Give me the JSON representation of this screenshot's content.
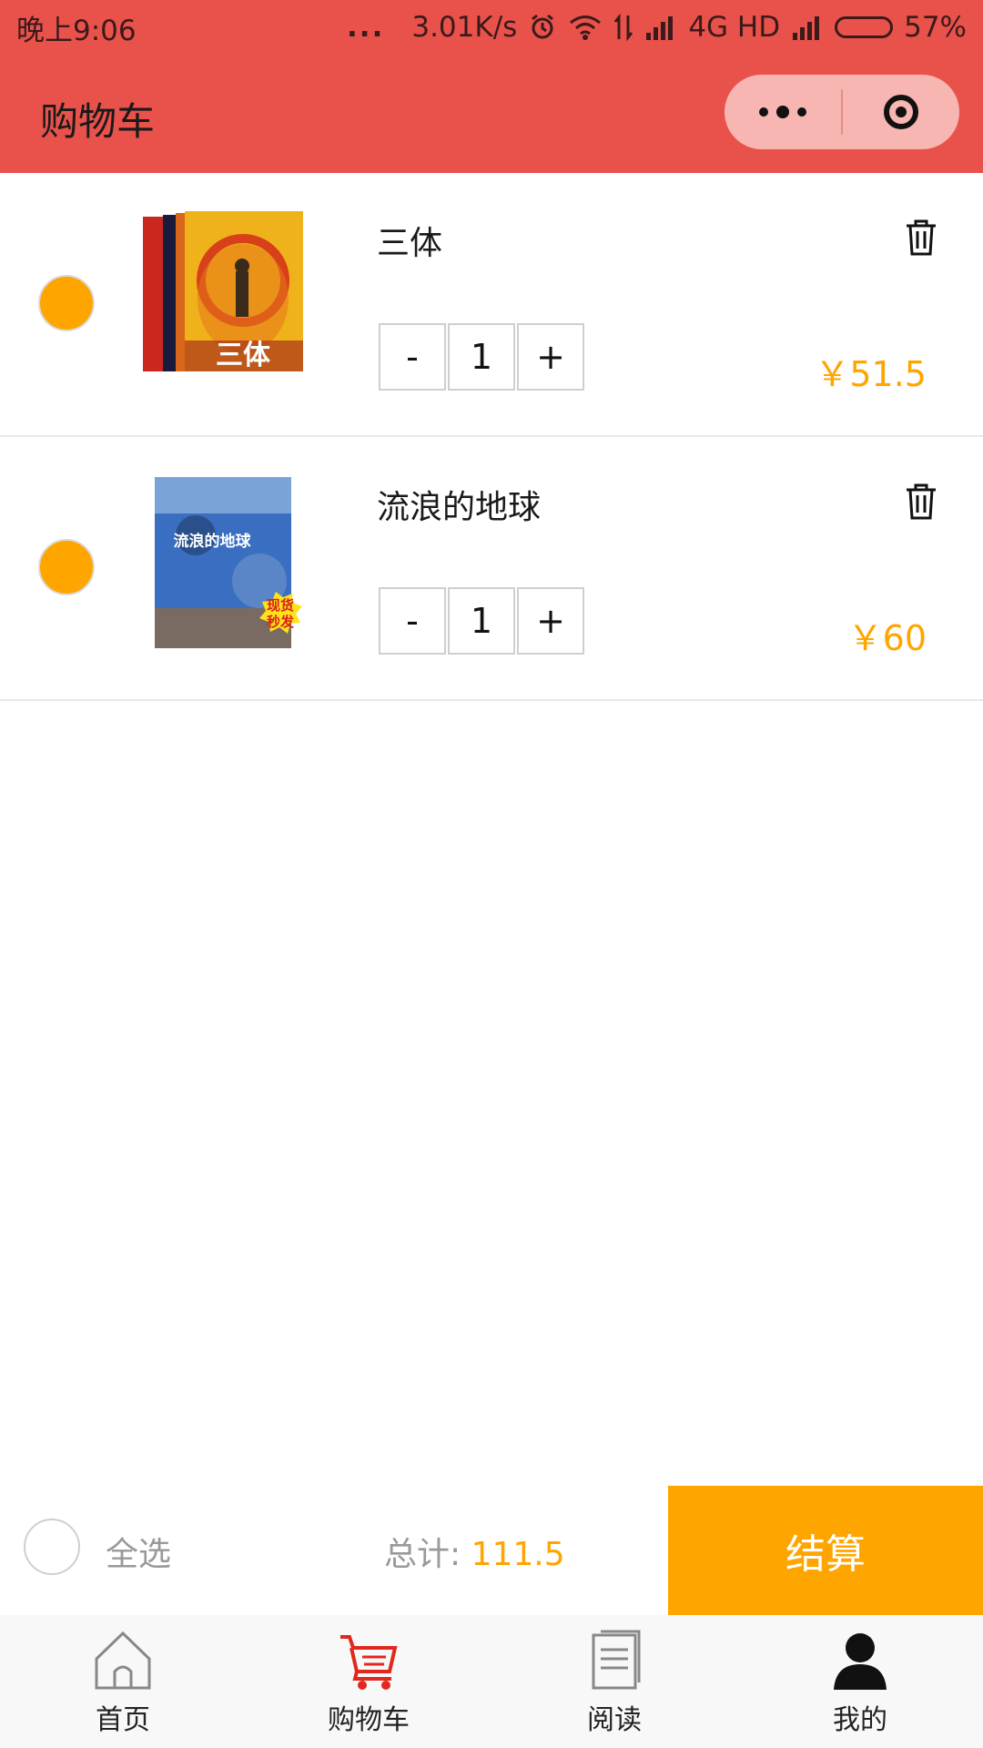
{
  "status_bar": {
    "time": "晚上9:06",
    "dots": "...",
    "net_speed": "3.01K/s",
    "network": "4G HD",
    "battery_level": 0.57,
    "battery_percent": "57%"
  },
  "header": {
    "title": "购物车"
  },
  "cart": {
    "items": [
      {
        "title": "三体",
        "quantity": "1",
        "price": "￥51.5",
        "selected": true,
        "cover_text": "三体"
      },
      {
        "title": "流浪的地球",
        "quantity": "1",
        "price": "￥60",
        "selected": true,
        "cover_text": "流浪的地球",
        "cover_badge_line1": "现货",
        "cover_badge_line2": "秒发"
      }
    ],
    "minus_label": "-",
    "plus_label": "+"
  },
  "summary": {
    "select_all_label": "全选",
    "total_label": "总计:",
    "total_value": "111.5",
    "checkout_label": "结算"
  },
  "tabbar": {
    "tabs": [
      {
        "label": "首页",
        "icon": "home-icon"
      },
      {
        "label": "购物车",
        "icon": "cart-icon"
      },
      {
        "label": "阅读",
        "icon": "reading-icon"
      },
      {
        "label": "我的",
        "icon": "profile-icon"
      }
    ]
  },
  "colors": {
    "header_red": "#e9524b",
    "accent_orange": "#ffa500",
    "active_tab_red": "#e0281e"
  }
}
